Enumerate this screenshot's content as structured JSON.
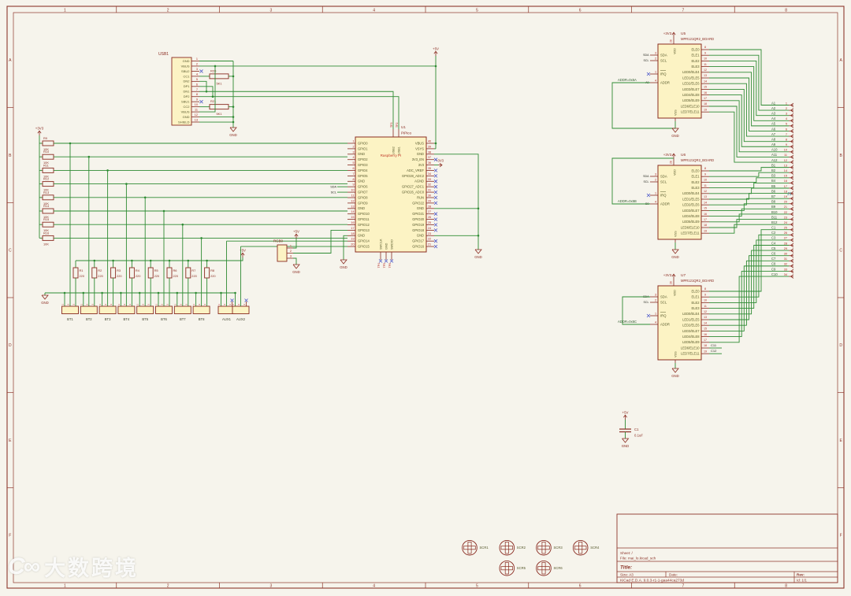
{
  "colors": {
    "bg": "#f6f4ec",
    "frame": "#8e372c",
    "wire": "#2e8b33",
    "symbol": "#8a2b21",
    "fill": "#fcf3c4",
    "pin_number": "#b3241e",
    "pin_name": "#56582b",
    "net_label": "#2d5a2d",
    "label_dark": "#26281f",
    "ref": "#8a2b21",
    "xmark": "#4f5ac8",
    "j1_ref": "#2e7f95",
    "inner_red": "#c23b2b",
    "btn_label": "#40422c"
  },
  "frame": {
    "columns": [
      "1",
      "2",
      "3",
      "4",
      "5",
      "6",
      "7",
      "8"
    ],
    "rows": [
      "A",
      "B",
      "C",
      "D",
      "E",
      "F"
    ]
  },
  "power": {
    "p5v": "+5V",
    "p3v3": "+3V3",
    "gnd": "GND"
  },
  "usb": {
    "ref": "USB1",
    "pin_names": [
      "GND",
      "VBUS",
      "SBU2",
      "CC1",
      "DN2",
      "DP1",
      "DN1",
      "DP2",
      "SBU1",
      "CC2",
      "VBUS",
      "GND",
      "SHIELD"
    ],
    "pin_numbers": [
      "1",
      "2",
      "3",
      "4",
      "5",
      "6",
      "7",
      "8",
      "9",
      "10",
      "11",
      "12",
      "13"
    ]
  },
  "r20": {
    "ref": "R20",
    "value": "5K1"
  },
  "r21": {
    "ref": "R21",
    "value": "5K1"
  },
  "pullups": {
    "refs": [
      "R9",
      "R10",
      "R11",
      "R12",
      "R13",
      "R14",
      "R15",
      "R16"
    ],
    "value": "10K"
  },
  "led_resistors": {
    "refs": [
      "R1",
      "R2",
      "R3",
      "R4",
      "R5",
      "R6",
      "R7",
      "R8"
    ],
    "value": "220"
  },
  "buttons": [
    "BT1",
    "BT2",
    "BT3",
    "BT4",
    "BT5",
    "BT6",
    "BT7",
    "BT8"
  ],
  "aux": [
    "AUX1",
    "AUX2"
  ],
  "button_pin_numbers": [
    "1",
    "2",
    "3"
  ],
  "rgb": {
    "ref": "RGB0",
    "pin_numbers": [
      "1",
      "2",
      "3"
    ]
  },
  "pico": {
    "ref": "U1",
    "value": "PiPico",
    "inner_label": "Raspberry PI",
    "left_names": [
      "GPIO0",
      "GPIO1",
      "GND",
      "GPIO2",
      "GPIO3",
      "GPIO4",
      "GPIO5",
      "GND",
      "GPIO6",
      "GPIO7",
      "GPIO8",
      "GPIO9",
      "GND",
      "GPIO10",
      "GPIO11",
      "GPIO12",
      "GPIO13",
      "GND",
      "GPIO14",
      "GPIO15"
    ],
    "left_numbers": [
      "1",
      "2",
      "3",
      "4",
      "5",
      "6",
      "7",
      "8",
      "9",
      "10",
      "11",
      "12",
      "13",
      "14",
      "15",
      "16",
      "17",
      "18",
      "19",
      "20"
    ],
    "right_names": [
      "VBUS",
      "VSYS",
      "GND",
      "3V3_EN",
      "3V3",
      "ADC_VREF",
      "GPIO28_ADC2",
      "AGND",
      "GPIO27_ADC1",
      "GPIO26_ADC0",
      "RUN",
      "GPIO22",
      "GND",
      "GPIO21",
      "GPIO20",
      "GPIO19",
      "GPIO18",
      "GND",
      "GPIO17",
      "GPIO16"
    ],
    "right_numbers": [
      "40",
      "39",
      "38",
      "37",
      "36",
      "35",
      "34",
      "33",
      "32",
      "31",
      "30",
      "29",
      "28",
      "27",
      "26",
      "25",
      "24",
      "23",
      "22",
      "21"
    ],
    "top_pins": [
      {
        "num": "TP3",
        "name": "USB2"
      },
      {
        "num": "TP2",
        "name": "USB1"
      }
    ],
    "bottom_pins": [
      {
        "num": "TP4",
        "name": "SWCLK"
      },
      {
        "num": "TP5",
        "name": "GND"
      },
      {
        "num": "TP6",
        "name": "SWDIO"
      }
    ],
    "sda_label": "SDA",
    "scl_label": "SCL"
  },
  "chips": [
    {
      "ref": "U5",
      "value": "MPR121QR2_BOARD",
      "addr_label": "ADDR=0x5A",
      "addr_net": "A0"
    },
    {
      "ref": "U6",
      "value": "MPR121QR2_BOARD",
      "addr_label": "ADDR=0x5B",
      "addr_net": "B0"
    },
    {
      "ref": "U7",
      "value": "MPR121QR2_BOARD",
      "addr_label": "ADDR=0x5C",
      "addr_net": "",
      "extra_nets": [
        "C11",
        "C12"
      ]
    }
  ],
  "chip_pins": {
    "left_names": [
      "SDA",
      "SCL",
      "IRQ",
      "ADDR"
    ],
    "left_numbers": [
      "3",
      "2",
      "1",
      "4"
    ],
    "right_names": [
      "ELE0",
      "ELE1",
      "ELE2",
      "ELE3",
      "LED0/ELE4",
      "LED1/ELE5",
      "LED2/ELE6",
      "LED3/ELE7",
      "LED4/ELE8",
      "LED5/ELE9",
      "LED6/ELE10",
      "LED7/ELE11"
    ],
    "right_numbers": [
      "8",
      "9",
      "10",
      "11",
      "12",
      "13",
      "14",
      "15",
      "16",
      "17",
      "18",
      "19"
    ],
    "vdd": "VDD",
    "vss": "VSS",
    "vdd_number": "28"
  },
  "j1": {
    "ref": "J1",
    "nets": [
      "A1",
      "A2",
      "A3",
      "A4",
      "A5",
      "A6",
      "A7",
      "A8",
      "A9",
      "A10",
      "A11",
      "A12",
      "B1",
      "B2",
      "B3",
      "B4",
      "B5",
      "B6",
      "B7",
      "B8",
      "B9",
      "B10",
      "B11",
      "B12",
      "C1",
      "C2",
      "C3",
      "C4",
      "C5",
      "C6",
      "C7",
      "C8",
      "C9",
      "C10"
    ],
    "numbers": [
      "1",
      "2",
      "3",
      "4",
      "5",
      "6",
      "7",
      "8",
      "9",
      "10",
      "11",
      "12",
      "13",
      "14",
      "15",
      "16",
      "17",
      "18",
      "19",
      "20",
      "21",
      "22",
      "23",
      "24",
      "25",
      "26",
      "27",
      "28",
      "29",
      "30",
      "31",
      "32",
      "33",
      "34"
    ]
  },
  "c1": {
    "ref": "C1",
    "value": "0.1uF"
  },
  "screws": [
    "SCR1",
    "SCR2",
    "SCR3",
    "SCR4",
    "SCR5",
    "SCR6"
  ],
  "title_block": {
    "sheet": "Sheet: /",
    "file": "File: mai_lo.kicad_sch",
    "title": "Title:",
    "size": "Size: A3",
    "date": "Date:",
    "rev": "Rev:",
    "generator": "KiCad E.D.A. 9.0.3-r1-1-gaa44ca273d",
    "id": "Id: 1/1"
  },
  "watermark": {
    "logo": "C∞",
    "text": "大数跨境"
  }
}
